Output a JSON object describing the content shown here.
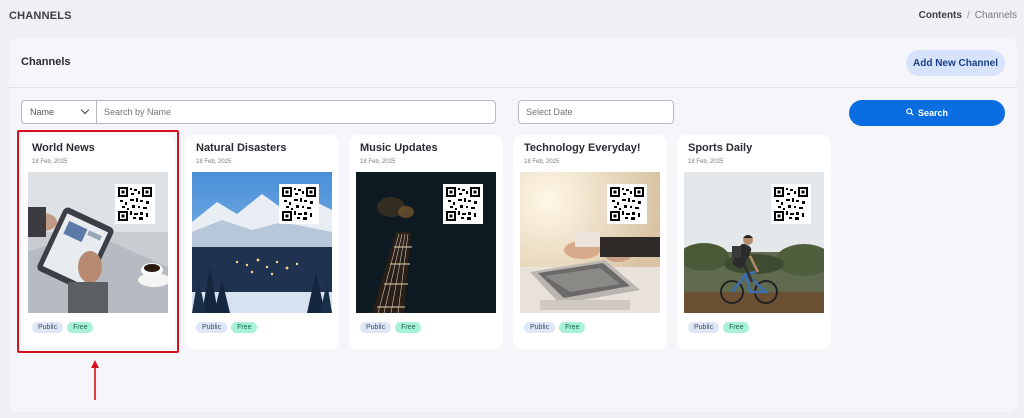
{
  "page": {
    "title": "CHANNELS"
  },
  "breadcrumb": {
    "home": "Contents",
    "separator": "/",
    "current": "Channels"
  },
  "panel": {
    "title": "Channels",
    "add_button": "Add New Channel"
  },
  "filters": {
    "field_select": "Name",
    "search_placeholder": "Search by Name",
    "date_placeholder": "Select Date",
    "search_button": "Search"
  },
  "cards": [
    {
      "title": "World News",
      "date": "18 Feb, 2025",
      "badges": [
        "Public",
        "Free"
      ],
      "image": "tablet-news-photo"
    },
    {
      "title": "Natural Disasters",
      "date": "18 Feb, 2025",
      "badges": [
        "Public",
        "Free"
      ],
      "image": "snowy-mountain-town-photo"
    },
    {
      "title": "Music Updates",
      "date": "18 Feb, 2025",
      "badges": [
        "Public",
        "Free"
      ],
      "image": "guitar-neck-photo"
    },
    {
      "title": "Technology Everyday!",
      "date": "18 Feb, 2025",
      "badges": [
        "Public",
        "Free"
      ],
      "image": "laptop-typing-photo"
    },
    {
      "title": "Sports Daily",
      "date": "18 Feb, 2025",
      "badges": [
        "Public",
        "Free"
      ],
      "image": "mountain-biker-photo"
    }
  ],
  "colors": {
    "accent": "#0b6ee0",
    "highlight": "#d6101c",
    "free_badge": "#a8f0d6",
    "public_badge": "#dfe6f5"
  }
}
